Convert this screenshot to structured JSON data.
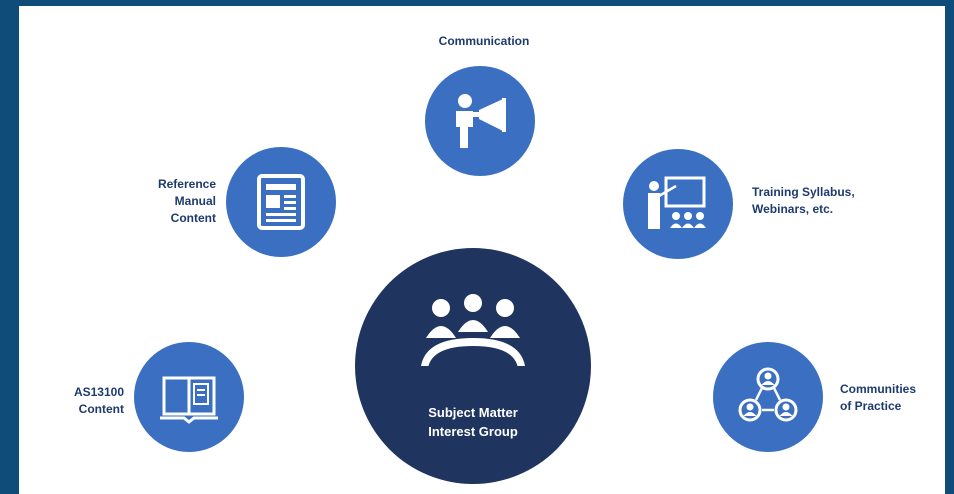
{
  "colors": {
    "frame": "#0f4c7a",
    "satellite": "#3a6fc1",
    "center": "#1f3560",
    "label": "#1f3a6e"
  },
  "center": {
    "line1": "Subject Matter",
    "line2": "Interest Group",
    "icon": "meeting-table-icon"
  },
  "nodes": {
    "communication": {
      "label": "Communication",
      "icon": "megaphone-person-icon"
    },
    "reference": {
      "line1": "Reference",
      "line2": "Manual",
      "line3": "Content",
      "icon": "newspaper-icon"
    },
    "training": {
      "line1": "Training Syllabus,",
      "line2": "Webinars, etc.",
      "icon": "presentation-icon"
    },
    "as13100": {
      "line1": "AS13100",
      "line2": "Content",
      "icon": "open-book-icon"
    },
    "communities": {
      "line1": "Communities",
      "line2": "of Practice",
      "icon": "network-people-icon"
    }
  }
}
